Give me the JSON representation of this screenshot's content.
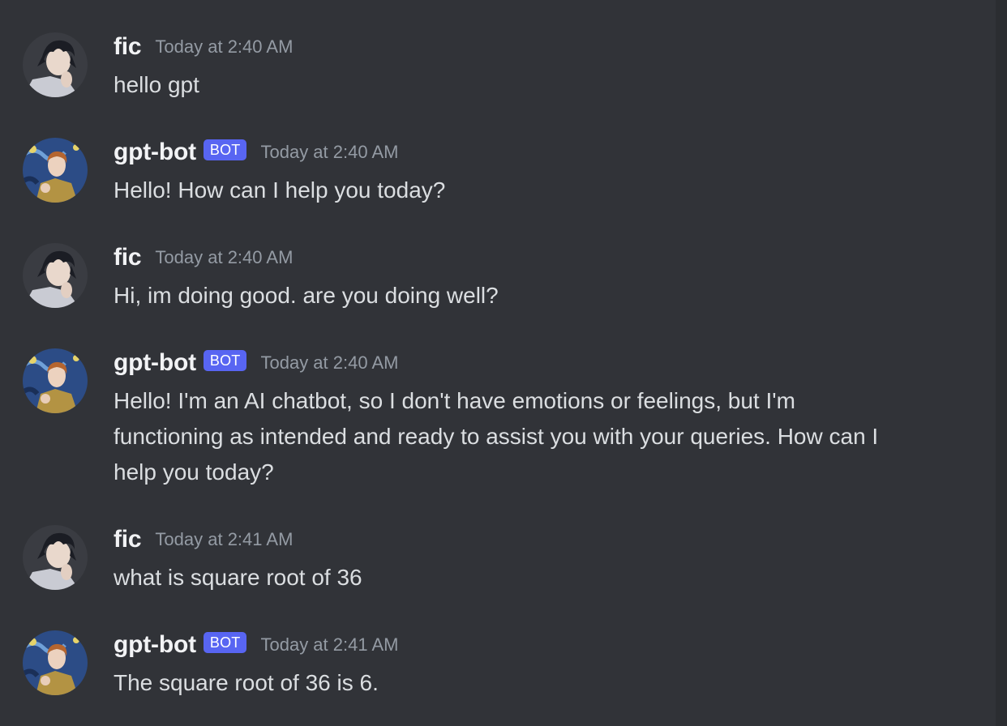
{
  "messages": [
    {
      "author": "fic",
      "bot": false,
      "timestamp": "Today at 2:40 AM",
      "text": "hello gpt"
    },
    {
      "author": "gpt-bot",
      "bot": true,
      "bot_tag": "BOT",
      "timestamp": "Today at 2:40 AM",
      "text": "Hello! How can I help you today?"
    },
    {
      "author": "fic",
      "bot": false,
      "timestamp": "Today at 2:40 AM",
      "text": "Hi, im doing good. are you doing well?"
    },
    {
      "author": "gpt-bot",
      "bot": true,
      "bot_tag": "BOT",
      "timestamp": "Today at 2:40 AM",
      "text": "Hello! I'm an AI chatbot, so I don't have emotions or feelings, but I'm functioning as intended and ready to assist you with your queries. How can I help you today?"
    },
    {
      "author": "fic",
      "bot": false,
      "timestamp": "Today at 2:41 AM",
      "text": "what is square root of 36"
    },
    {
      "author": "gpt-bot",
      "bot": true,
      "bot_tag": "BOT",
      "timestamp": "Today at 2:41 AM",
      "text": "The square root of 36 is 6."
    }
  ],
  "icons": {
    "user_avatar": "anime-boy-avatar-icon",
    "bot_avatar": "starry-night-portrait-avatar-icon"
  },
  "colors": {
    "background": "#313338",
    "bot_tag": "#5865f2",
    "username": "#f2f3f5",
    "timestamp": "#949ba4",
    "message_text": "#dbdee1"
  }
}
